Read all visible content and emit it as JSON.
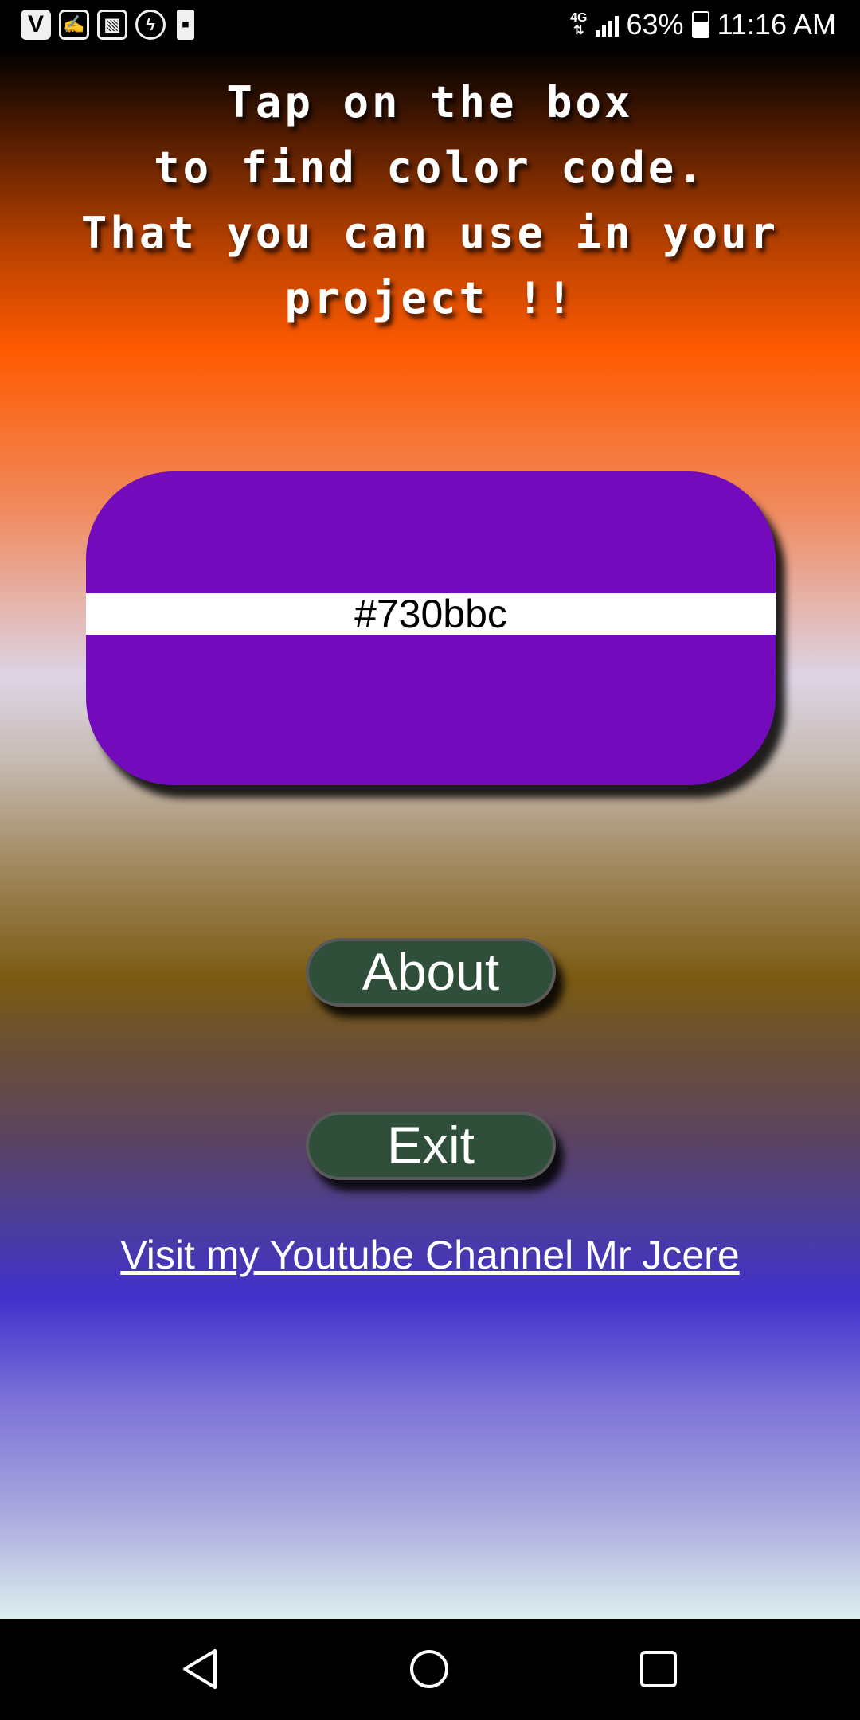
{
  "status_bar": {
    "notification_icons": [
      {
        "name": "vivo-app-icon",
        "glyph": "V"
      },
      {
        "name": "signing-app-icon",
        "glyph": "✍"
      },
      {
        "name": "gallery-icon",
        "glyph": "▧"
      },
      {
        "name": "flash-app-icon",
        "glyph": "ϟ"
      },
      {
        "name": "sim-icon",
        "glyph": "▪"
      }
    ],
    "network": "4G",
    "battery": "63%",
    "battery_level": 0.63,
    "time": "11:16 AM"
  },
  "instructions": {
    "lines": [
      "Tap on the box",
      "to find color code.",
      "That you can use in your",
      "project !!"
    ]
  },
  "color_box": {
    "code_label": "#730bbc",
    "color": "#730bbc"
  },
  "buttons": {
    "about_label": "About",
    "exit_label": "Exit"
  },
  "youtube_link": {
    "label": "Visit my Youtube Channel Mr Jcere"
  },
  "nav_bar": {
    "icons": [
      "back-icon",
      "home-icon",
      "recents-icon"
    ]
  }
}
